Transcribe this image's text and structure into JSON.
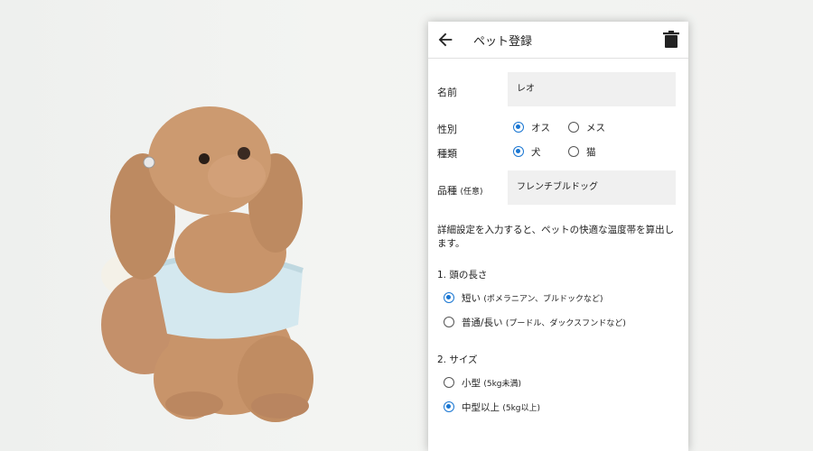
{
  "header": {
    "title": "ペット登録",
    "back_icon": "arrow-back-icon",
    "delete_icon": "trash-icon"
  },
  "form": {
    "name": {
      "label": "名前",
      "value": "レオ"
    },
    "sex": {
      "label": "性別",
      "options": [
        "オス",
        "メス"
      ],
      "selected": "オス"
    },
    "kind": {
      "label": "種類",
      "options": [
        "犬",
        "猫"
      ],
      "selected": "犬"
    },
    "breed": {
      "label": "品種",
      "label_note": "(任意)",
      "value": "フレンチブルドッグ"
    }
  },
  "description": "詳細設定を入力すると、ペットの快適な温度帯を算出します。",
  "head_length": {
    "title": "1. 頭の長さ",
    "options": [
      {
        "label": "短い",
        "note": "(ポメラニアン、ブルドックなど)",
        "selected": true
      },
      {
        "label": "普通/長い",
        "note": "(プードル、ダックスフンドなど)",
        "selected": false
      }
    ]
  },
  "size": {
    "title": "2. サイズ",
    "options": [
      {
        "label": "小型",
        "note": "(5kg未満)",
        "selected": false
      },
      {
        "label": "中型以上",
        "note": "(5kg以上)",
        "selected": true
      }
    ]
  },
  "colors": {
    "accent": "#1976d2",
    "dog_fur": "#c8946a",
    "sweater": "#d4e8ef"
  }
}
